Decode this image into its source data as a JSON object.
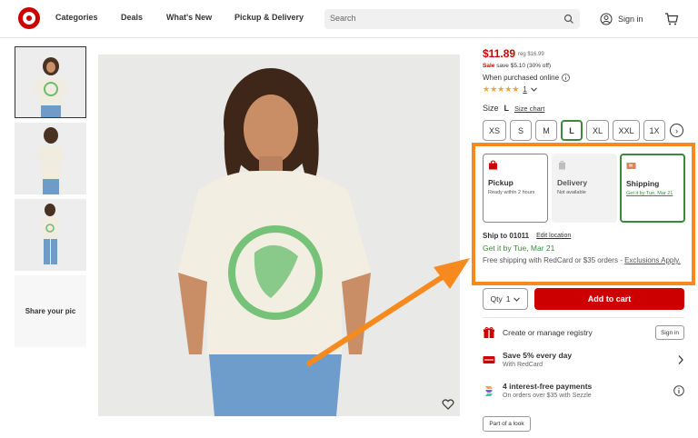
{
  "header": {
    "nav": [
      "Categories",
      "Deals",
      "What's New",
      "Pickup & Delivery"
    ],
    "search_placeholder": "Search",
    "signin_label": "Sign in"
  },
  "gallery": {
    "share_label": "Share your pic"
  },
  "product": {
    "price": "$11.89",
    "reg_price": "reg $16.99",
    "sale_label": "Sale",
    "save_text": "save $5.10 (30% off)",
    "online_note": "When purchased online",
    "rating_stars": "★★★★★",
    "rating_count": "1",
    "size_label": "Size",
    "size_selected": "L",
    "size_chart_label": "Size chart",
    "sizes": [
      "XS",
      "S",
      "M",
      "L",
      "XL",
      "XXL",
      "1X"
    ]
  },
  "fulfillment": {
    "options": [
      {
        "title": "Pickup",
        "sub": "Ready within 2 hours"
      },
      {
        "title": "Delivery",
        "sub": "Not available"
      },
      {
        "title": "Shipping",
        "sub": "Get it by Tue, Mar 21"
      }
    ],
    "ship_to": "Ship to 01011",
    "edit_location": "Edit location",
    "get_by": "Get it by Tue, Mar 21",
    "free_shipping": "Free shipping with RedCard or $35 orders -",
    "exclusions": "Exclusions Apply."
  },
  "cart": {
    "qty_label": "Qty",
    "qty_value": "1",
    "add_to_cart": "Add to cart"
  },
  "extras": {
    "registry": "Create or manage registry",
    "registry_signin": "Sign in",
    "redcard_title": "Save 5% every day",
    "redcard_sub": "With RedCard",
    "sezzle_title": "4 interest-free payments",
    "sezzle_sub": "On orders over $35 with Sezzle",
    "part_of_look": "Part of a look"
  },
  "colors": {
    "brand_red": "#cc0000",
    "highlight_orange": "#f68a1e",
    "success_green": "#3b8a3b"
  }
}
